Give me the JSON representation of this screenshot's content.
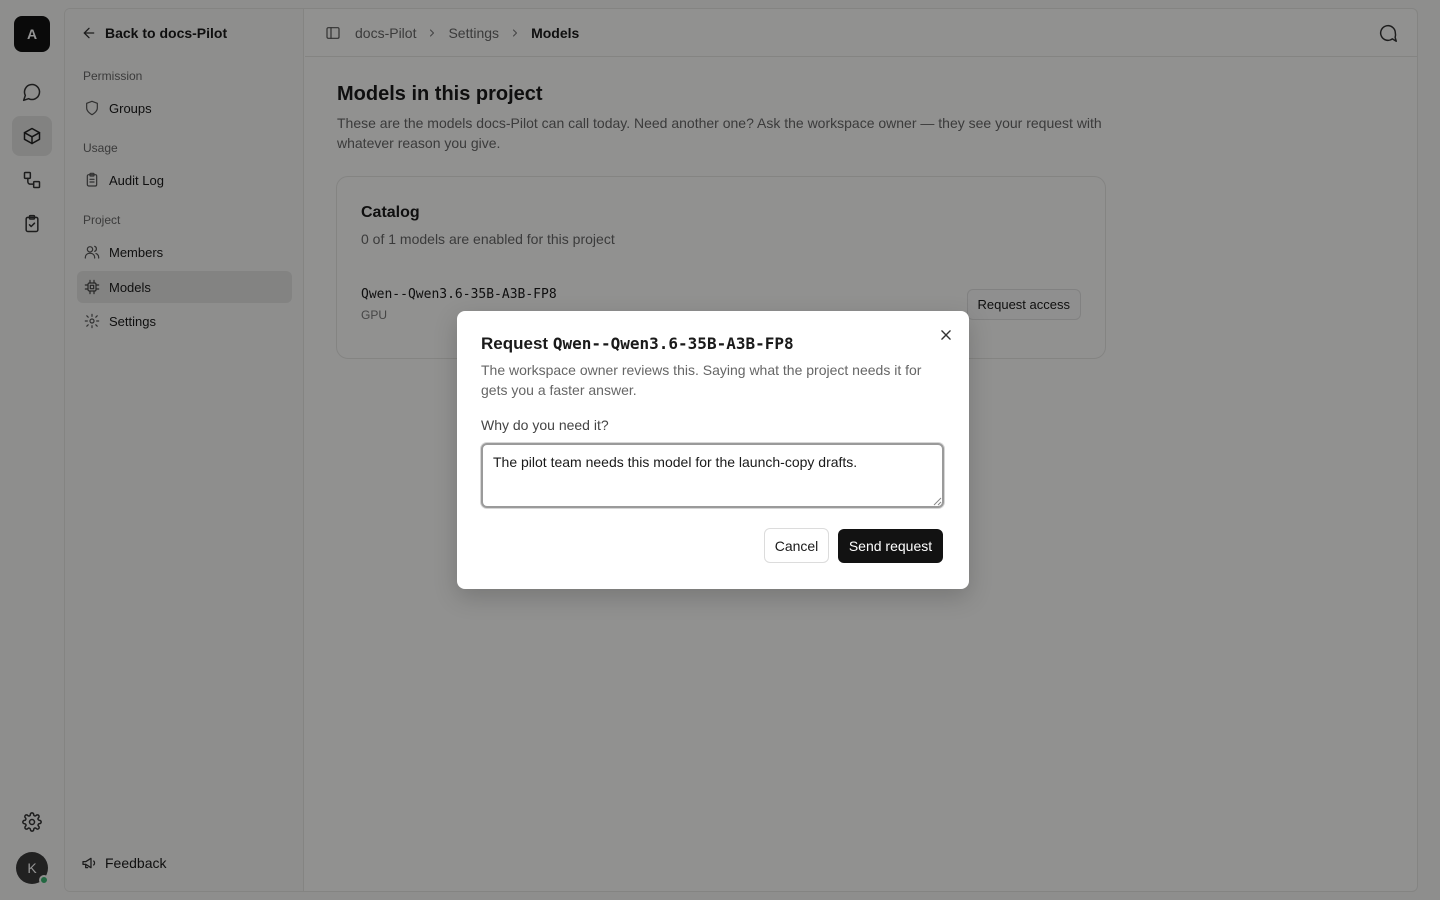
{
  "rail": {
    "logo_letter": "A",
    "items": [
      {
        "name": "chat",
        "icon": "chat-bubble-icon",
        "active": false
      },
      {
        "name": "models",
        "icon": "cube-icon",
        "active": true
      },
      {
        "name": "workflows",
        "icon": "workflow-icon",
        "active": false
      },
      {
        "name": "tasks",
        "icon": "clipboard-check-icon",
        "active": false
      }
    ],
    "settings_icon": "gear-icon",
    "user_initial": "K",
    "status_color": "#3cb371"
  },
  "sidebar": {
    "back_label": "Back to docs-Pilot",
    "sections": [
      {
        "label": "Permission",
        "items": [
          {
            "label": "Groups",
            "icon": "shield-icon"
          }
        ]
      },
      {
        "label": "Usage",
        "items": [
          {
            "label": "Audit Log",
            "icon": "clipboard-icon"
          }
        ]
      },
      {
        "label": "Project",
        "items": [
          {
            "label": "Members",
            "icon": "users-icon"
          },
          {
            "label": "Models",
            "icon": "chip-icon",
            "active": true
          },
          {
            "label": "Settings",
            "icon": "gear-icon"
          }
        ]
      }
    ],
    "feedback_label": "Feedback"
  },
  "topbar": {
    "breadcrumbs": [
      "docs-Pilot",
      "Settings",
      "Models"
    ]
  },
  "main": {
    "title": "Models in this project",
    "description": "These are the models docs-Pilot can call today. Need another one? Ask the workspace owner — they see your request with whatever reason you give.",
    "catalog": {
      "title": "Catalog",
      "subtitle": "0 of 1 models are enabled for this project",
      "models": [
        {
          "name": "Qwen--Qwen3.6-35B-A3B-FP8",
          "type": "GPU",
          "action": "Request access"
        }
      ]
    }
  },
  "dialog": {
    "title_prefix": "Request",
    "title_model": "Qwen--Qwen3.6-35B-A3B-FP8",
    "description": "The workspace owner reviews this. Saying what the project needs it for gets you a faster answer.",
    "field_label": "Why do you need it?",
    "field_value": "The pilot team needs this model for the launch-copy drafts.",
    "cancel_label": "Cancel",
    "send_label": "Send request"
  },
  "colors": {
    "accent": "#121212",
    "active_nav": "#e2e2e0",
    "overlay": "rgba(0,0,0,0.42)"
  }
}
